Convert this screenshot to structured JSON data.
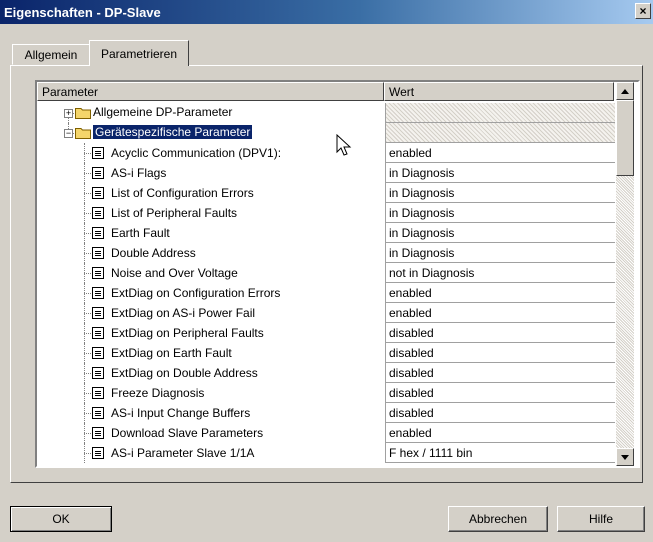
{
  "window": {
    "title": "Eigenschaften - DP-Slave",
    "close_glyph": "×"
  },
  "tabs": [
    {
      "label": "Allgemein",
      "active": false
    },
    {
      "label": "Parametrieren",
      "active": true
    }
  ],
  "table": {
    "columns": [
      "Parameter",
      "Wert"
    ],
    "rows": [
      {
        "name": "Allgemeine DP-Parameter",
        "value": "",
        "type": "folder",
        "expander": "+"
      },
      {
        "name": "Gerätespezifische Parameter",
        "value": "",
        "type": "folder",
        "expander": "−",
        "selected": true
      },
      {
        "name": "Acyclic Communication (DPV1):",
        "value": "enabled",
        "type": "param"
      },
      {
        "name": "AS-i Flags",
        "value": "in Diagnosis",
        "type": "param"
      },
      {
        "name": "List of Configuration Errors",
        "value": "in Diagnosis",
        "type": "param"
      },
      {
        "name": "List of Peripheral Faults",
        "value": "in Diagnosis",
        "type": "param"
      },
      {
        "name": "Earth Fault",
        "value": "in Diagnosis",
        "type": "param"
      },
      {
        "name": "Double Address",
        "value": "in Diagnosis",
        "type": "param"
      },
      {
        "name": "Noise and Over Voltage",
        "value": "not in Diagnosis",
        "type": "param"
      },
      {
        "name": "ExtDiag on Configuration Errors",
        "value": "enabled",
        "type": "param"
      },
      {
        "name": "ExtDiag on AS-i Power Fail",
        "value": "enabled",
        "type": "param"
      },
      {
        "name": "ExtDiag on Peripheral Faults",
        "value": "disabled",
        "type": "param"
      },
      {
        "name": "ExtDiag on Earth Fault",
        "value": "disabled",
        "type": "param"
      },
      {
        "name": "ExtDiag on Double Address",
        "value": "disabled",
        "type": "param"
      },
      {
        "name": "Freeze Diagnosis",
        "value": "disabled",
        "type": "param"
      },
      {
        "name": "AS-i Input Change Buffers",
        "value": "disabled",
        "type": "param"
      },
      {
        "name": "Download Slave Parameters",
        "value": "enabled",
        "type": "param"
      },
      {
        "name": "AS-i Parameter Slave 1/1A",
        "value": "F hex / 1111 bin",
        "type": "param"
      }
    ]
  },
  "buttons": {
    "ok": "OK",
    "cancel": "Abbrechen",
    "help": "Hilfe"
  },
  "colors": {
    "selection": "#0a246a",
    "title_gradient_start": "#0a246a",
    "face": "#d4d0c8"
  }
}
